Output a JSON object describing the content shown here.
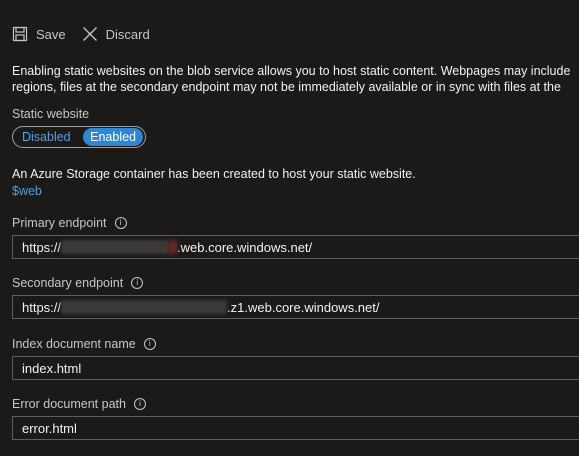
{
  "toolbar": {
    "save_label": "Save",
    "discard_label": "Discard"
  },
  "description": {
    "line1": "Enabling static websites on the blob service allows you to host static content. Webpages may include",
    "line2": "regions, files at the secondary endpoint may not be immediately available or in sync with files at the"
  },
  "static_website": {
    "label": "Static website",
    "options": [
      "Disabled",
      "Enabled"
    ],
    "selected": "Enabled"
  },
  "container_info": "An Azure Storage container has been created to host your static website.",
  "container_link": "$web",
  "primary_endpoint": {
    "label": "Primary endpoint",
    "prefix": "https://",
    "suffix": ".web.core.windows.net/"
  },
  "secondary_endpoint": {
    "label": "Secondary endpoint",
    "prefix": "https://",
    "suffix": ".z1.web.core.windows.net/"
  },
  "index_document": {
    "label": "Index document name",
    "value": "index.html"
  },
  "error_document": {
    "label": "Error document path",
    "value": "error.html"
  },
  "icons": {
    "save": "save-icon",
    "discard": "close-icon",
    "info": "info-icon"
  },
  "colors": {
    "background": "#1b1a19",
    "accent": "#2b88d8",
    "link": "#4aa0e6",
    "border": "#605e5c"
  }
}
